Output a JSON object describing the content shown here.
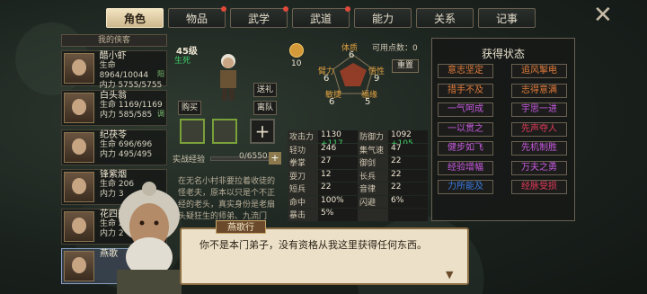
{
  "tabs": [
    {
      "label": "角色",
      "active": true,
      "dot": false
    },
    {
      "label": "物品",
      "active": false,
      "dot": true
    },
    {
      "label": "武学",
      "active": false,
      "dot": true
    },
    {
      "label": "武道",
      "active": false,
      "dot": true
    },
    {
      "label": "能力",
      "active": false,
      "dot": false
    },
    {
      "label": "关系",
      "active": false,
      "dot": false
    },
    {
      "label": "记事",
      "active": false,
      "dot": false
    }
  ],
  "left": {
    "title": "我的侠客",
    "heroes": [
      {
        "name": "醋小虾",
        "hp": "生命 8964/10044",
        "mp": "内力 5755/5755",
        "tag": "阳"
      },
      {
        "name": "白头翁",
        "hp": "生命 1169/1169",
        "mp": "内力 585/585",
        "tag": "调"
      },
      {
        "name": "纪茯苓",
        "hp": "生命 696/696",
        "mp": "内力 495/495",
        "tag": ""
      },
      {
        "name": "锋紫烟",
        "hp": "生命 206",
        "mp": "内力 3",
        "tag": ""
      },
      {
        "name": "花四娘",
        "hp": "生命 2",
        "mp": "内力 2",
        "tag": ""
      },
      {
        "name": "燕歌",
        "hp": "",
        "mp": "",
        "tag": ""
      }
    ]
  },
  "character": {
    "level": "45级",
    "status": "生死",
    "buy": "购买",
    "gift": "送礼",
    "leave": "离队",
    "exp_label": "实战经验",
    "exp_value": "0/6550",
    "desc": "在无名小村非要拉着收徒的怪老夫，原本以只是个不正经的老头，真实身份是老扇头疑狂生的师弟、九流门"
  },
  "radar": {
    "coin_value": "10",
    "free_points": "可用点数：0",
    "reset": "重置",
    "labels": [
      {
        "k": "体质",
        "v": "6"
      },
      {
        "k": "悟性",
        "v": "9"
      },
      {
        "k": "福缘",
        "v": "5"
      },
      {
        "k": "敏捷",
        "v": "6"
      },
      {
        "k": "臂力",
        "v": "6"
      }
    ]
  },
  "stats": [
    [
      {
        "k": "攻击力",
        "v": "1130",
        "p": "+117"
      },
      {
        "k": "防御力",
        "v": "1092",
        "p": "+105"
      }
    ],
    [
      {
        "k": "轻功",
        "v": "246",
        "p": ""
      },
      {
        "k": "集气速度",
        "v": "47",
        "p": ""
      }
    ],
    [
      {
        "k": "拳掌",
        "v": "27",
        "p": ""
      },
      {
        "k": "御剑",
        "v": "22",
        "p": ""
      }
    ],
    [
      {
        "k": "耍刀",
        "v": "12",
        "p": ""
      },
      {
        "k": "长兵",
        "v": "22",
        "p": ""
      }
    ],
    [
      {
        "k": "短兵",
        "v": "22",
        "p": ""
      },
      {
        "k": "音律",
        "v": "22",
        "p": ""
      }
    ],
    [
      {
        "k": "命中",
        "v": "100%",
        "p": ""
      },
      {
        "k": "闪避",
        "v": "6%",
        "p": ""
      }
    ],
    [
      {
        "k": "暴击",
        "v": "5%",
        "p": ""
      },
      {
        "k": "",
        "v": "",
        "p": ""
      }
    ]
  ],
  "right": {
    "title": "获得状态",
    "skills": [
      {
        "label": "意志坚定",
        "color": "#e07a3a"
      },
      {
        "label": "追风掣电",
        "color": "#e07a3a"
      },
      {
        "label": "措手不及",
        "color": "#e07a3a"
      },
      {
        "label": "志得意满",
        "color": "#e07a3a"
      },
      {
        "label": "一气呵成",
        "color": "#c85ae0"
      },
      {
        "label": "宇思一进",
        "color": "#c85ae0"
      },
      {
        "label": "一以贯之",
        "color": "#c85ae0"
      },
      {
        "label": "先声夺人",
        "color": "#e03a5a"
      },
      {
        "label": "健步如飞",
        "color": "#c85ae0"
      },
      {
        "label": "先机制胜",
        "color": "#c85ae0"
      },
      {
        "label": "经验增幅",
        "color": "#c85ae0"
      },
      {
        "label": "万夫之勇",
        "color": "#c85ae0"
      },
      {
        "label": "力所能及",
        "color": "#3a7ae0"
      },
      {
        "label": "经脉受损",
        "color": "#e03a5a"
      }
    ]
  },
  "dialog": {
    "speaker": "燕歌行",
    "text": "你不是本门弟子，没有资格从我这里获得任何东西。"
  }
}
